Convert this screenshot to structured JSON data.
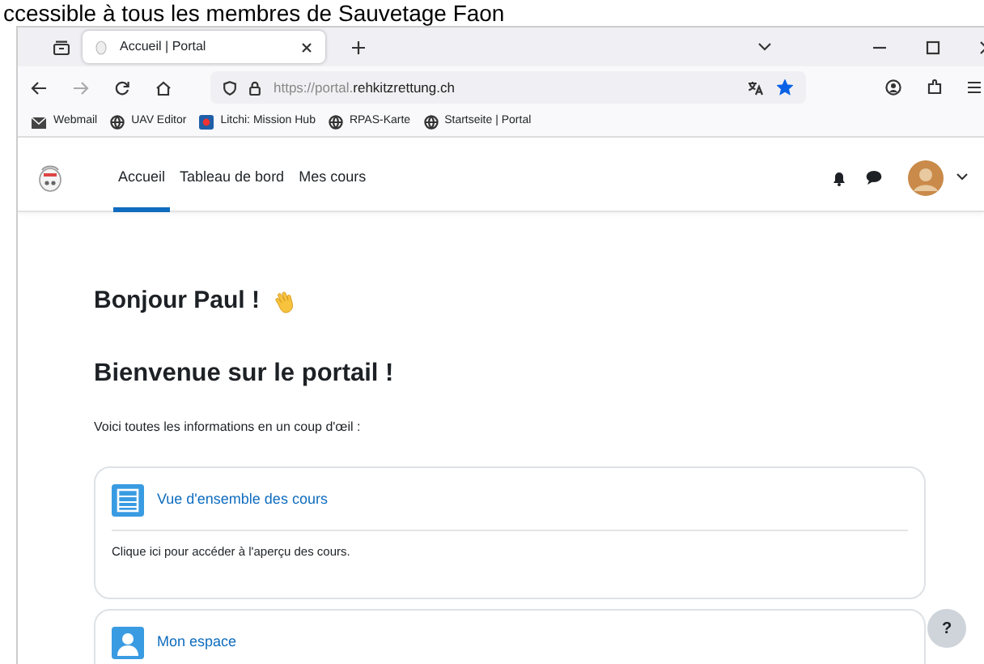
{
  "caption": "ccessible à tous les membres de Sauvetage Faon",
  "browser": {
    "tab_title": "Accueil | Portal",
    "url_prefix": "https://portal.",
    "url_domain": "rehkitzrettung.ch",
    "bookmarked": true,
    "bookmarks": [
      {
        "label": "Webmail",
        "kind": "mail"
      },
      {
        "label": "UAV Editor",
        "kind": "globe"
      },
      {
        "label": "Litchi: Mission Hub",
        "kind": "app"
      },
      {
        "label": "RPAS-Karte",
        "kind": "globe"
      },
      {
        "label": "Startseite | Portal",
        "kind": "globe"
      }
    ]
  },
  "nav": [
    {
      "label": "Accueil",
      "selected": true
    },
    {
      "label": "Tableau de bord",
      "selected": false
    },
    {
      "label": "Mes cours",
      "selected": false
    }
  ],
  "greeting": "Bonjour Paul !",
  "title": "Bienvenue sur le portail !",
  "intro": "Voici toutes les informations en un coup d'œil :",
  "cards": [
    {
      "kind": "list",
      "title": "Vue d'ensemble des cours",
      "text": "Clique ici pour accéder à l'aperçu des cours."
    },
    {
      "kind": "user",
      "title": "Mon espace"
    }
  ],
  "help": "?"
}
